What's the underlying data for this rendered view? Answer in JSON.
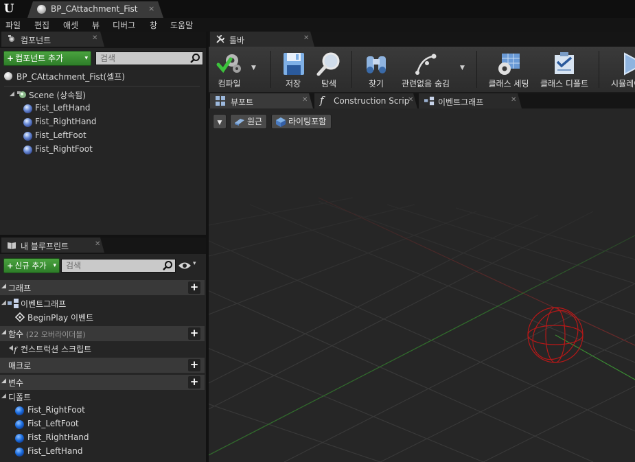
{
  "title_bar": {
    "logo": "U",
    "document_tab": "BP_CAttachment_Fist",
    "close": "×"
  },
  "menu": [
    "파일",
    "편집",
    "애셋",
    "뷰",
    "디버그",
    "창",
    "도움말"
  ],
  "components_panel": {
    "tab_label": "컴포넌트",
    "add_button": "컴포넌트 추가",
    "search_placeholder": "검색",
    "root": "BP_CAttachment_Fist(셀프)",
    "scene": "Scene (상속됨)",
    "children": [
      "Fist_LeftHand",
      "Fist_RightHand",
      "Fist_LeftFoot",
      "Fist_RightFoot"
    ]
  },
  "my_blueprint_panel": {
    "tab_label": "내 블루프린트",
    "add_new_button": "신규 추가",
    "search_placeholder": "검색",
    "sections": {
      "graphs": "그래프",
      "event_graph": "이벤트그래프",
      "begin_play": "BeginPlay 이벤트",
      "functions": "함수",
      "functions_sub": "(22 오버라이더블)",
      "construction_script": "컨스트럭션 스크립트",
      "macros": "매크로",
      "variables": "변수",
      "defaults": "디폴트"
    },
    "variables": [
      "Fist_RightFoot",
      "Fist_LeftFoot",
      "Fist_RightHand",
      "Fist_LeftHand"
    ]
  },
  "toolbar_panel": {
    "tab_label": "툴바",
    "buttons": {
      "compile": "컴파일",
      "save": "저장",
      "browse": "탐색",
      "find": "찾기",
      "hide_unrelated": "관련없음 숨김",
      "class_settings": "클래스 세팅",
      "class_defaults": "클래스 디폴트",
      "simulate": "시뮬레이션"
    }
  },
  "editor_tabs": {
    "viewport": "뷰포트",
    "construction_script": "Construction Scrip",
    "event_graph": "이벤트그래프"
  },
  "viewport": {
    "perspective": "원근",
    "lit": "라이팅포함"
  },
  "colors": {
    "accent_green": "#3f9a36",
    "viewport_bg": "#262626",
    "grid": "#3a3a3a",
    "axis_green": "#2f6e2a",
    "axis_red": "#7a2a2a",
    "gizmo_red": "#c01818"
  }
}
